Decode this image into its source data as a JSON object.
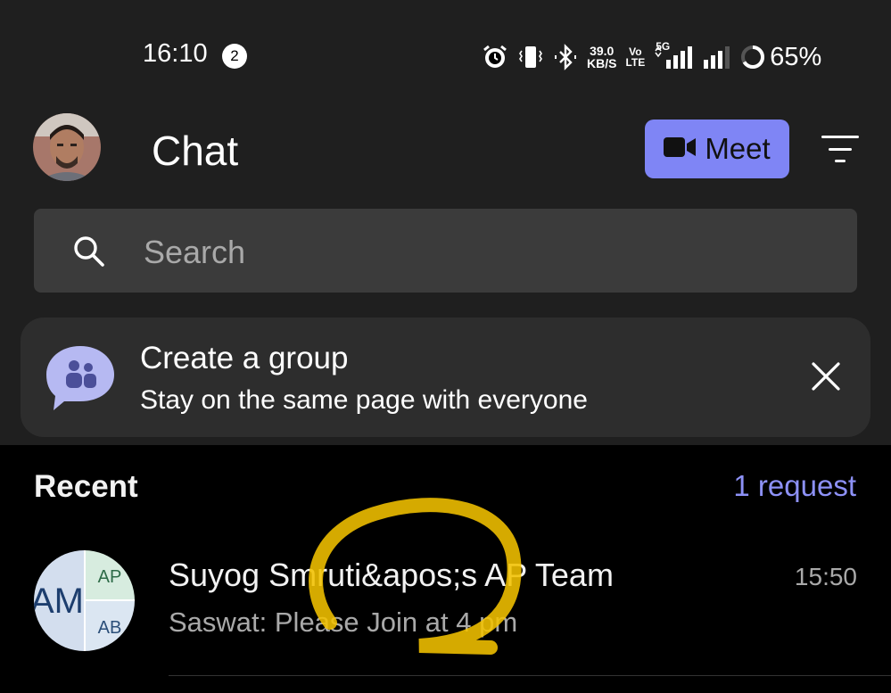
{
  "status_bar": {
    "time": "16:10",
    "notification_count": "2",
    "net_speed_value": "39.0",
    "net_speed_unit": "KB/S",
    "volte_top": "Vo",
    "volte_bottom": "LTE",
    "network_type": "5G",
    "battery_percent": "65%"
  },
  "header": {
    "title": "Chat",
    "meet_label": "Meet",
    "accent_color": "#7f85f5"
  },
  "search": {
    "placeholder": "Search"
  },
  "create_group_card": {
    "title": "Create a group",
    "subtitle": "Stay on the same page with everyone"
  },
  "recent": {
    "label": "Recent",
    "request_link": "1 request",
    "chats": [
      {
        "name": "Suyog Smruti&apos;s AP Team",
        "time": "15:50",
        "preview": "Saswat: Please Join at 4 pm",
        "avatar": {
          "main": "AM",
          "top_right": "AP",
          "bottom_right": "AB"
        }
      }
    ]
  },
  "icons": [
    "alarm-icon",
    "vibrate-icon",
    "bluetooth-icon",
    "signal-icon",
    "battery-icon",
    "video-camera-icon",
    "filter-icon",
    "search-icon",
    "group-chat-icon",
    "close-icon"
  ]
}
